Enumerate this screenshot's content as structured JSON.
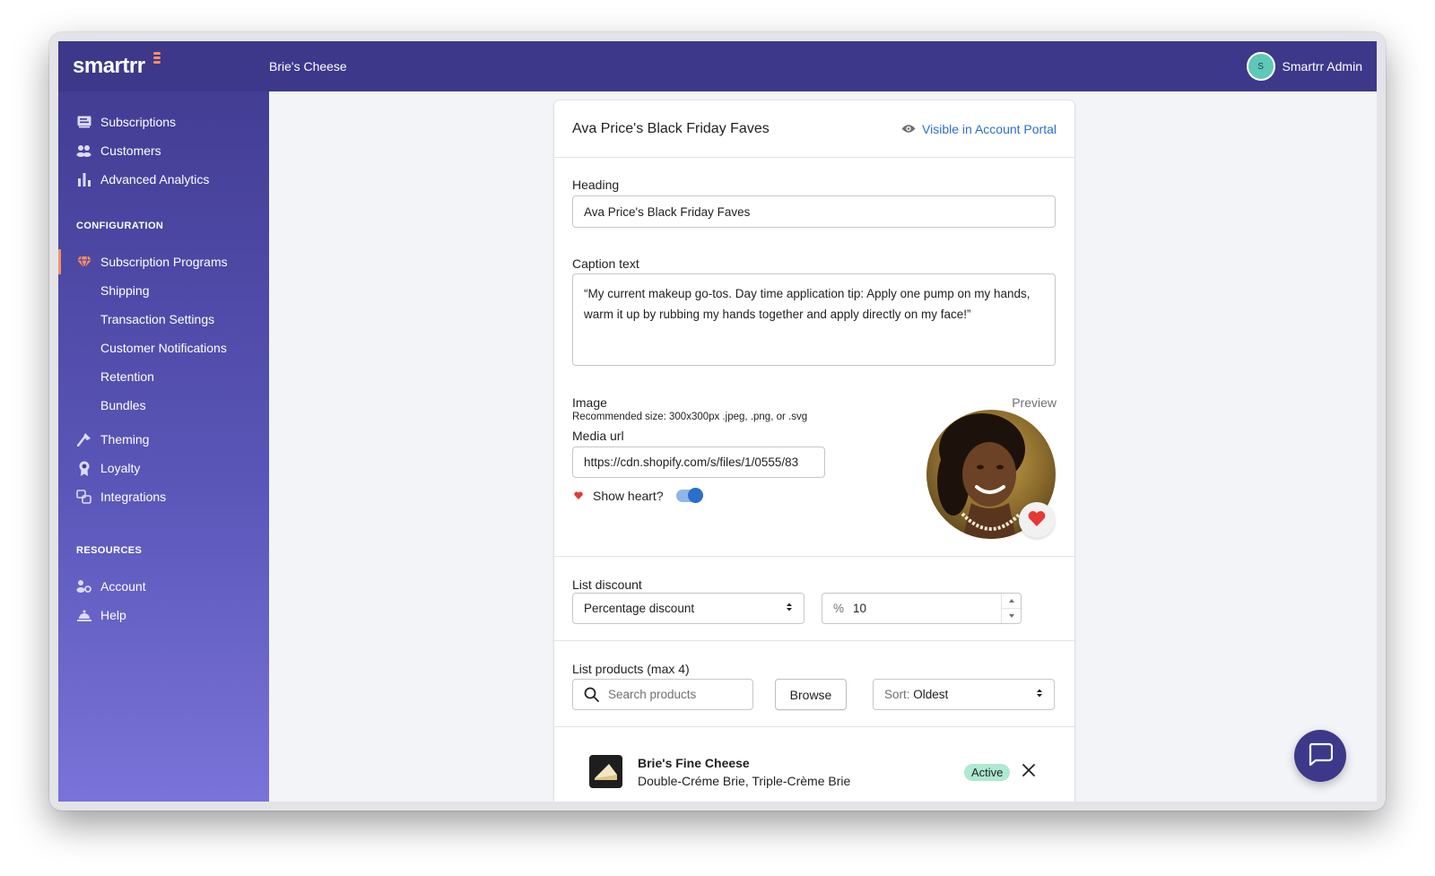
{
  "topbar": {
    "logo": "smartrr",
    "store_name": "Brie's Cheese",
    "avatar_initial": "S",
    "user_name": "Smartrr Admin"
  },
  "sidebar": {
    "main_items": [
      {
        "label": "Subscriptions",
        "icon": "subscriptions-icon"
      },
      {
        "label": "Customers",
        "icon": "customers-icon"
      },
      {
        "label": "Advanced Analytics",
        "icon": "analytics-icon"
      }
    ],
    "configuration_title": "CONFIGURATION",
    "configuration_items": [
      {
        "label": "Subscription Programs",
        "icon": "gem-icon",
        "active": true
      },
      {
        "label": "Shipping"
      },
      {
        "label": "Transaction Settings"
      },
      {
        "label": "Customer Notifications"
      },
      {
        "label": "Retention"
      },
      {
        "label": "Bundles"
      },
      {
        "label": "Theming",
        "icon": "theming-icon"
      },
      {
        "label": "Loyalty",
        "icon": "loyalty-icon"
      },
      {
        "label": "Integrations",
        "icon": "integrations-icon"
      }
    ],
    "resources_title": "RESOURCES",
    "resources_items": [
      {
        "label": "Account",
        "icon": "account-icon"
      },
      {
        "label": "Help",
        "icon": "help-icon"
      }
    ]
  },
  "card": {
    "title": "Ava Price's Black Friday Faves",
    "visibility_label": "Visible in Account Portal",
    "heading_label": "Heading",
    "heading_value": "Ava Price's Black Friday Faves",
    "caption_label": "Caption text",
    "caption_value": "“My current makeup go-tos. Day time application tip: Apply one pump on my hands, warm it up by rubbing my hands together and apply directly on my face!”",
    "image_label": "Image",
    "image_hint": "Recommended size: 300x300px .jpeg, .png, or .svg",
    "preview_label": "Preview",
    "media_url_label": "Media url",
    "media_url_value": "https://cdn.shopify.com/s/files/1/0555/83",
    "show_heart_label": "Show heart?",
    "show_heart_enabled": true,
    "list_discount_label": "List discount",
    "discount_type_value": "Percentage discount",
    "discount_prefix": "%",
    "discount_amount": "10",
    "list_products_label": "List products (max 4)",
    "search_placeholder": "Search products",
    "browse_label": "Browse",
    "sort_prefix": "Sort:",
    "sort_value": "Oldest",
    "products": [
      {
        "name": "Brie's Fine Cheese",
        "variants": "Double-Créme Brie, Triple-Crème Brie",
        "status": "Active"
      }
    ]
  },
  "colors": {
    "topbar": "#3d3889",
    "accent": "#f48f66",
    "link": "#2c6ecb",
    "active_badge": "#aee9d1"
  }
}
